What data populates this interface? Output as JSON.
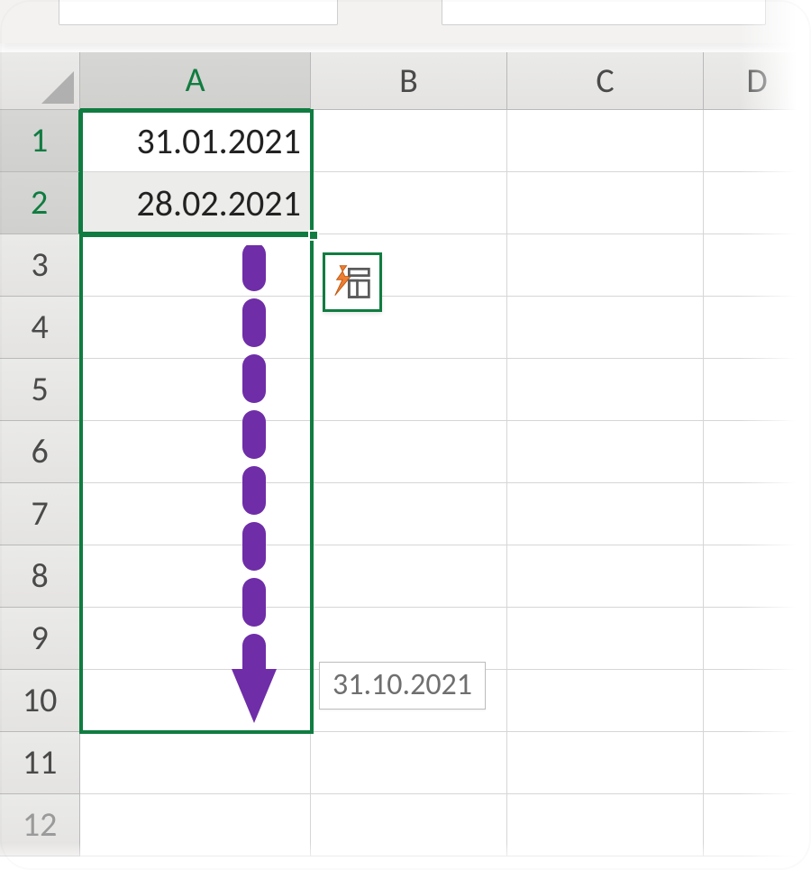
{
  "columns": {
    "A": "A",
    "B": "B",
    "C": "C",
    "D": "D"
  },
  "row_labels": [
    "1",
    "2",
    "3",
    "4",
    "5",
    "6",
    "7",
    "8",
    "9",
    "10",
    "11",
    "12"
  ],
  "cells": {
    "A1": "31.01.2021",
    "A2": "28.02.2021"
  },
  "fill_preview": "31.10.2021",
  "selection": {
    "active_range": "A1:A2",
    "drag_target_range": "A1:A10"
  },
  "colors": {
    "selection_border": "#107c41",
    "arrow": "#6f2da8"
  },
  "icons": {
    "quick_analysis": "quick-analysis-icon"
  }
}
